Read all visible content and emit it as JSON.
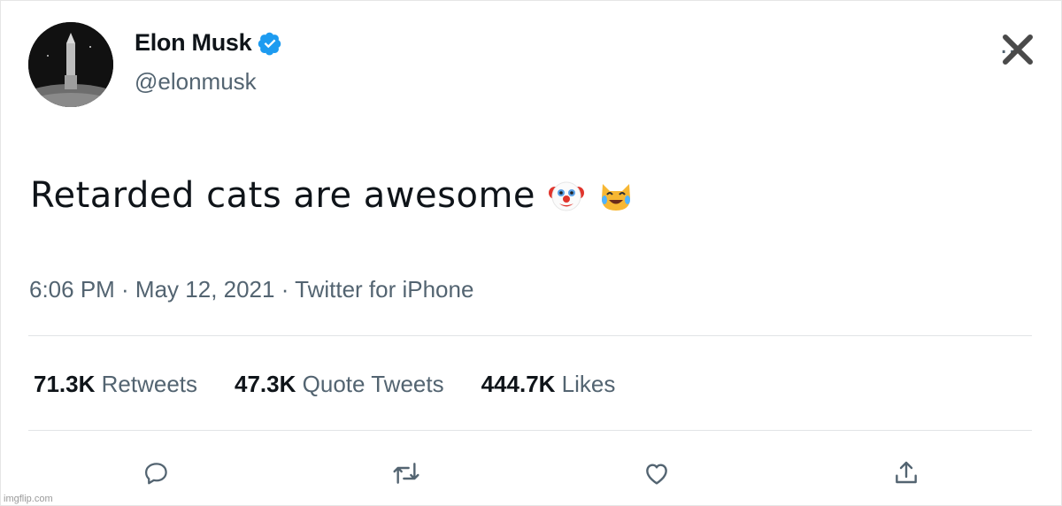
{
  "author": {
    "name": "Elon Musk",
    "handle": "@elonmusk",
    "verified_color": "#1d9bf0"
  },
  "tweet": {
    "text": "Retarded cats are awesome",
    "emojis": [
      "clown-face-emoji",
      "cat-tears-of-joy-emoji"
    ],
    "meta": "6:06 PM · May 12, 2021 · Twitter for iPhone"
  },
  "stats": [
    {
      "count": "71.3K",
      "label": "Retweets"
    },
    {
      "count": "47.3K",
      "label": "Quote Tweets"
    },
    {
      "count": "444.7K",
      "label": "Likes"
    }
  ],
  "more_menu": {
    "dots": "..."
  },
  "actions": [
    "reply-icon",
    "retweet-icon",
    "like-icon",
    "share-icon"
  ],
  "watermark": "imgflip.com",
  "colors": {
    "text": "#0f1419",
    "secondary": "#536471",
    "accent": "#1d9bf0"
  }
}
